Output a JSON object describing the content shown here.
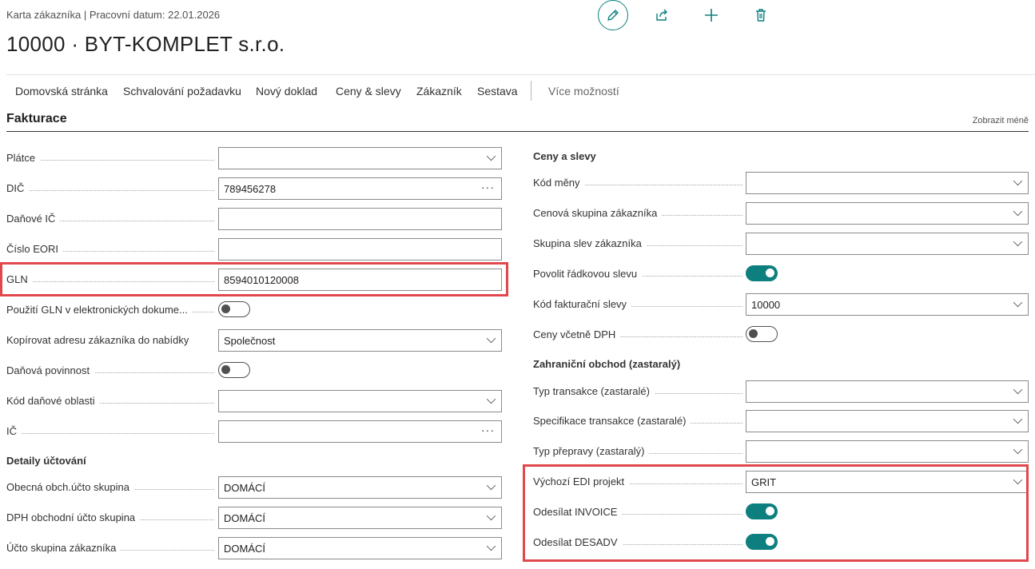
{
  "header": {
    "breadcrumb": "Karta zákazníka | Pracovní datum: 22.01.2026",
    "title": "10000 · BYT-KOMPLET s.r.o."
  },
  "top_actions": [
    "edit-icon",
    "share-icon",
    "add-icon",
    "delete-icon"
  ],
  "actionbar": {
    "items": [
      "Domovská stránka",
      "Schvalování požadavku",
      "Nový doklad",
      "Ceny & slevy",
      "Zákazník",
      "Sestava"
    ],
    "more": "Více možností"
  },
  "section": {
    "title": "Fakturace",
    "show_less": "Zobrazit méně"
  },
  "left": {
    "fields": [
      {
        "label": "Plátce",
        "value": "",
        "type": "select"
      },
      {
        "label": "DIČ",
        "value": "789456278",
        "type": "lookup"
      },
      {
        "label": "Daňové IČ",
        "value": "",
        "type": "text"
      },
      {
        "label": "Číslo EORI",
        "value": "",
        "type": "text"
      },
      {
        "label": "GLN",
        "value": "8594010120008",
        "type": "text"
      },
      {
        "label": "Použití GLN v elektronických dokume...",
        "value": false,
        "type": "toggle"
      },
      {
        "label": "Kopírovat adresu zákazníka do nabídky",
        "value": "Společnost",
        "type": "select"
      },
      {
        "label": "Daňová povinnost",
        "value": false,
        "type": "toggle"
      },
      {
        "label": "Kód daňové oblasti",
        "value": "",
        "type": "select"
      },
      {
        "label": "IČ",
        "value": "",
        "type": "lookup"
      }
    ],
    "posting_group_title": "Detaily účtování",
    "posting_fields": [
      {
        "label": "Obecná obch.účto skupina",
        "value": "DOMÁCÍ",
        "type": "select"
      },
      {
        "label": "DPH obchodní účto skupina",
        "value": "DOMÁCÍ",
        "type": "select"
      },
      {
        "label": "Účto skupina zákazníka",
        "value": "DOMÁCÍ",
        "type": "select"
      }
    ]
  },
  "right": {
    "prices_title": "Ceny a slevy",
    "prices_fields": [
      {
        "label": "Kód měny",
        "value": "",
        "type": "select"
      },
      {
        "label": "Cenová skupina zákazníka",
        "value": "",
        "type": "select"
      },
      {
        "label": "Skupina slev zákazníka",
        "value": "",
        "type": "select"
      },
      {
        "label": "Povolit řádkovou slevu",
        "value": true,
        "type": "toggle"
      },
      {
        "label": "Kód fakturační slevy",
        "value": "10000",
        "type": "select"
      },
      {
        "label": "Ceny včetně DPH",
        "value": false,
        "type": "toggle"
      }
    ],
    "foreign_title": "Zahraniční obchod (zastaralý)",
    "foreign_fields": [
      {
        "label": "Typ transakce (zastaralé)",
        "value": "",
        "type": "select"
      },
      {
        "label": "Specifikace transakce (zastaralé)",
        "value": "",
        "type": "select"
      },
      {
        "label": "Typ přepravy (zastaralý)",
        "value": "",
        "type": "select"
      }
    ],
    "edi_fields": [
      {
        "label": "Výchozí EDI projekt",
        "value": "GRIT",
        "type": "select"
      },
      {
        "label": "Odesílat INVOICE",
        "value": true,
        "type": "toggle"
      },
      {
        "label": "Odesílat DESADV",
        "value": true,
        "type": "toggle"
      }
    ]
  },
  "colors": {
    "accent": "#0e7f7f",
    "highlight": "#e0484d"
  }
}
